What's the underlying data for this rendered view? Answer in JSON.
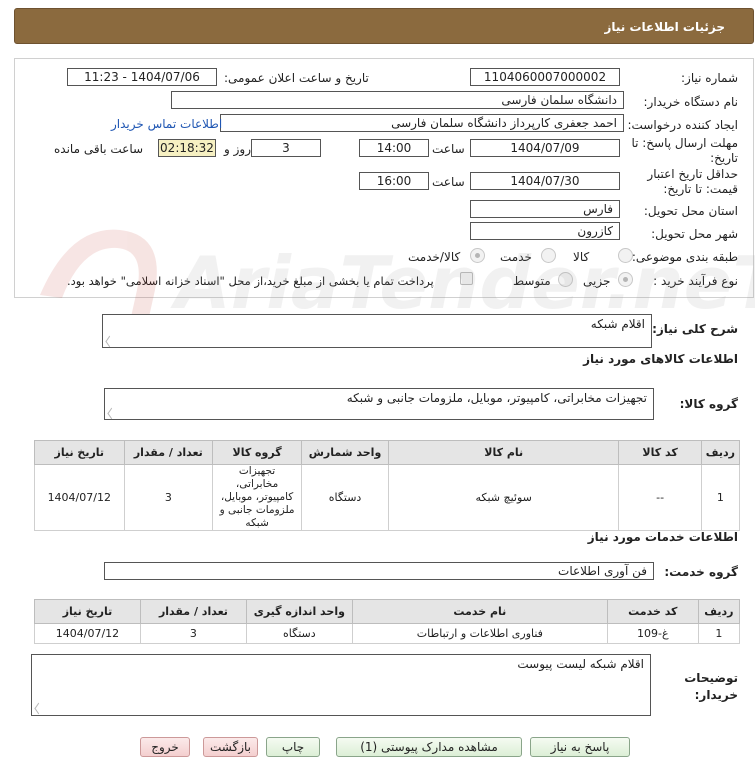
{
  "header": {
    "title": "جزئیات اطلاعات نیاز"
  },
  "form": {
    "need_number": {
      "label": "شماره نیاز:",
      "value": "1104060007000002"
    },
    "announce_datetime": {
      "label": "تاریخ و ساعت اعلان عمومی:",
      "value": "1404/07/06 - 11:23"
    },
    "buyer_org": {
      "label": "نام دستگاه خریدار:",
      "value": "دانشگاه سلمان فارسی"
    },
    "requester": {
      "label": "ایجاد کننده درخواست:",
      "value": "احمد جعفری کارپرداز دانشگاه سلمان فارسی",
      "contact_link": "اطلاعات تماس خریدار"
    },
    "deadline": {
      "label_line1": "مهلت ارسال پاسخ: تا",
      "label_line2": "تاریخ:",
      "date": "1404/07/09",
      "time_label": "ساعت",
      "time": "14:00",
      "days": "3",
      "days_label": "روز و",
      "remaining": "02:18:32",
      "remaining_label": "ساعت باقی مانده"
    },
    "validity": {
      "label_line1": "حداقل تاریخ اعتبار",
      "label_line2": "قیمت: تا تاریخ:",
      "date": "1404/07/30",
      "time_label": "ساعت",
      "time": "16:00"
    },
    "province": {
      "label": "استان محل تحویل:",
      "value": "فارس"
    },
    "city": {
      "label": "شهر محل تحویل:",
      "value": "کازرون"
    },
    "category": {
      "label": "طبقه بندی موضوعی:",
      "options": [
        "کالا",
        "خدمت",
        "کالا/خدمت"
      ],
      "selected_index": 2
    },
    "process": {
      "label": "نوع فرآیند خرید :",
      "options": [
        "جزیی",
        "متوسط"
      ],
      "selected_index": 0,
      "payment_note": "پرداخت تمام یا بخشی از مبلغ خرید،از محل \"اسناد خزانه اسلامی\" خواهد بود."
    }
  },
  "summary": {
    "label": "شرح کلی نیاز:",
    "value": "اقلام شبکه"
  },
  "goods_section": {
    "title": "اطلاعات کالاهای مورد نیاز",
    "group_label": "گروه کالا:",
    "group_value": "تجهیزات مخابراتی، کامپیوتر، موبایل، ملزومات جانبی و شبکه",
    "columns": [
      "ردیف",
      "کد کالا",
      "نام کالا",
      "واحد شمارش",
      "گروه کالا",
      "تعداد / مقدار",
      "تاریخ نیاز"
    ],
    "rows": [
      {
        "row": "1",
        "code": "--",
        "name": "سوئیچ شبکه",
        "unit": "دستگاه",
        "group": "تجهیزات مخابراتی، کامپیوتر، موبایل، ملزومات جانبی و شبکه",
        "qty": "3",
        "date": "1404/07/12"
      }
    ]
  },
  "services_section": {
    "title": "اطلاعات خدمات مورد نیاز",
    "group_label": "گروه خدمت:",
    "group_value": "فن آوری اطلاعات",
    "columns": [
      "ردیف",
      "کد خدمت",
      "نام خدمت",
      "واحد اندازه گیری",
      "تعداد / مقدار",
      "تاریخ نیاز"
    ],
    "rows": [
      {
        "row": "1",
        "code": "غ-109",
        "name": "فناوری اطلاعات و ارتباطات",
        "unit": "دستگاه",
        "qty": "3",
        "date": "1404/07/12"
      }
    ]
  },
  "buyer_notes": {
    "label_line1": "توضیحات",
    "label_line2": "خریدار:",
    "value": "اقلام شبکه لیست پیوست"
  },
  "buttons": {
    "reply": "پاسخ به نیاز",
    "view_docs": "مشاهده مدارک پیوستی (1)",
    "print": "چاپ",
    "back": "بازگشت",
    "exit": "خروج"
  },
  "watermark": {
    "text": "AriaTender.neT"
  },
  "colors": {
    "header_bg": "#8b6a3e",
    "remaining_bg": "#f6f0c2",
    "button_green": "#dcefd6",
    "button_red": "#f4cfcf"
  }
}
